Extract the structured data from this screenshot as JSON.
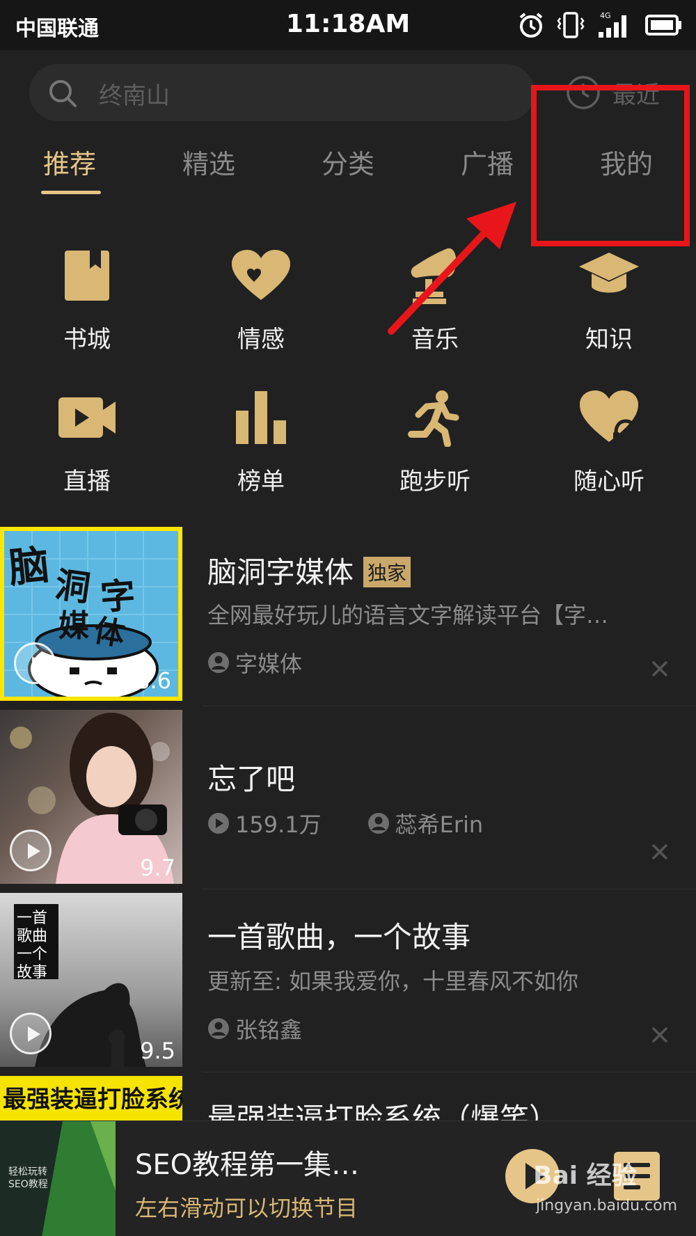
{
  "status_bar": {
    "carrier": "中国联通",
    "time": "11:18AM",
    "network": "4G"
  },
  "search": {
    "placeholder": "终南山",
    "recent_label": "最近"
  },
  "tabs": [
    {
      "label": "推荐",
      "active": true
    },
    {
      "label": "精选"
    },
    {
      "label": "分类"
    },
    {
      "label": "广播"
    },
    {
      "label": "我的"
    }
  ],
  "categories": [
    {
      "label": "书城",
      "icon": "book-icon"
    },
    {
      "label": "情感",
      "icon": "heart-icon"
    },
    {
      "label": "音乐",
      "icon": "gramophone-icon"
    },
    {
      "label": "知识",
      "icon": "graduation-cap-icon"
    },
    {
      "label": "直播",
      "icon": "video-camera-icon"
    },
    {
      "label": "榜单",
      "icon": "bar-chart-icon"
    },
    {
      "label": "跑步听",
      "icon": "runner-icon"
    },
    {
      "label": "随心听",
      "icon": "heart-headphones-icon"
    }
  ],
  "list": [
    {
      "title": "脑洞字媒体",
      "badge": "独家",
      "desc": "全网最好玩儿的语言文字解读平台【字…",
      "author": "字媒体",
      "score": "8.6",
      "cover_text": [
        "脑",
        "洞",
        "字",
        "媒",
        "体"
      ]
    },
    {
      "title": "忘了吧",
      "plays": "159.1万",
      "author": "蕊希Erin",
      "score": "9.7"
    },
    {
      "title": "一首歌曲，一个故事",
      "desc": "更新至: 如果我爱你，十里春风不如你",
      "author": "张铭鑫",
      "score": "9.5",
      "cover_text": "一首歌曲一个故事"
    },
    {
      "title": "最强装逼打脸系统（爆笑）",
      "cover_text": "最强装逼打脸系统"
    }
  ],
  "player": {
    "title": "SEO教程第一集…",
    "hint": "左右滑动可以切换节目",
    "cover_text": "轻松玩转 SEO教程"
  },
  "watermark": {
    "brand": "Bai 经验",
    "url": "jingyan.baidu.com"
  },
  "colors": {
    "accent": "#e6c588",
    "background": "#212121",
    "annotation": "#e8161a"
  }
}
